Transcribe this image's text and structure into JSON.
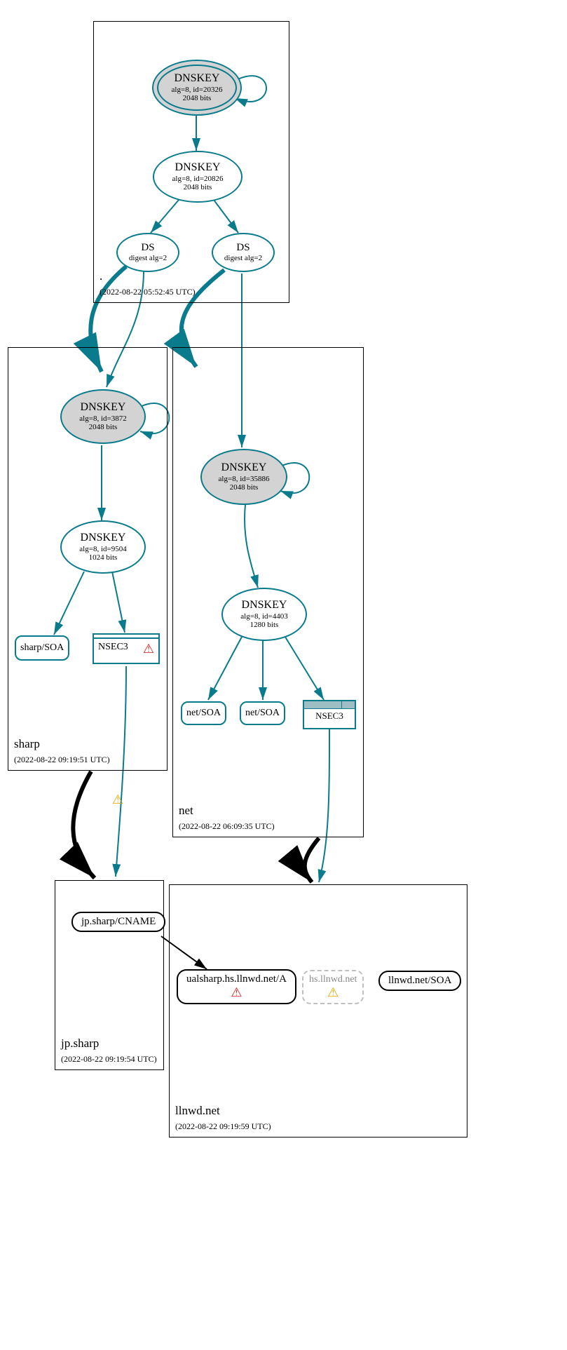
{
  "zones": {
    "root": {
      "name": ".",
      "timestamp": "(2022-08-22 05:52:45 UTC)"
    },
    "sharp": {
      "name": "sharp",
      "timestamp": "(2022-08-22 09:19:51 UTC)"
    },
    "net": {
      "name": "net",
      "timestamp": "(2022-08-22 06:09:35 UTC)"
    },
    "jpsharp": {
      "name": "jp.sharp",
      "timestamp": "(2022-08-22 09:19:54 UTC)"
    },
    "llnwd": {
      "name": "llnwd.net",
      "timestamp": "(2022-08-22 09:19:59 UTC)"
    }
  },
  "keys": {
    "root_ksk": {
      "title": "DNSKEY",
      "l2": "alg=8, id=20326",
      "l3": "2048 bits"
    },
    "root_zsk": {
      "title": "DNSKEY",
      "l2": "alg=8, id=20826",
      "l3": "2048 bits"
    },
    "sharp_ksk": {
      "title": "DNSKEY",
      "l2": "alg=8, id=3872",
      "l3": "2048 bits"
    },
    "sharp_zsk": {
      "title": "DNSKEY",
      "l2": "alg=8, id=9504",
      "l3": "1024 bits"
    },
    "net_ksk": {
      "title": "DNSKEY",
      "l2": "alg=8, id=35886",
      "l3": "2048 bits"
    },
    "net_zsk": {
      "title": "DNSKEY",
      "l2": "alg=8, id=4403",
      "l3": "1280 bits"
    }
  },
  "ds": {
    "left": {
      "title": "DS",
      "l2": "digest alg=2"
    },
    "right": {
      "title": "DS",
      "l2": "digest alg=2"
    }
  },
  "records": {
    "sharp_soa": "sharp/SOA",
    "nsec_sharp": "NSEC3",
    "net_soa1": "net/SOA",
    "net_soa2": "net/SOA",
    "nsec_net": "NSEC3",
    "cname": "jp.sharp/CNAME",
    "ualsharp": "ualsharp.hs.llnwd.net/A",
    "hsllnwd": "hs.llnwd.net",
    "llnwd_soa": "llnwd.net/SOA"
  },
  "icons": {
    "warn_y": "⚠",
    "warn_r": "⚠"
  }
}
